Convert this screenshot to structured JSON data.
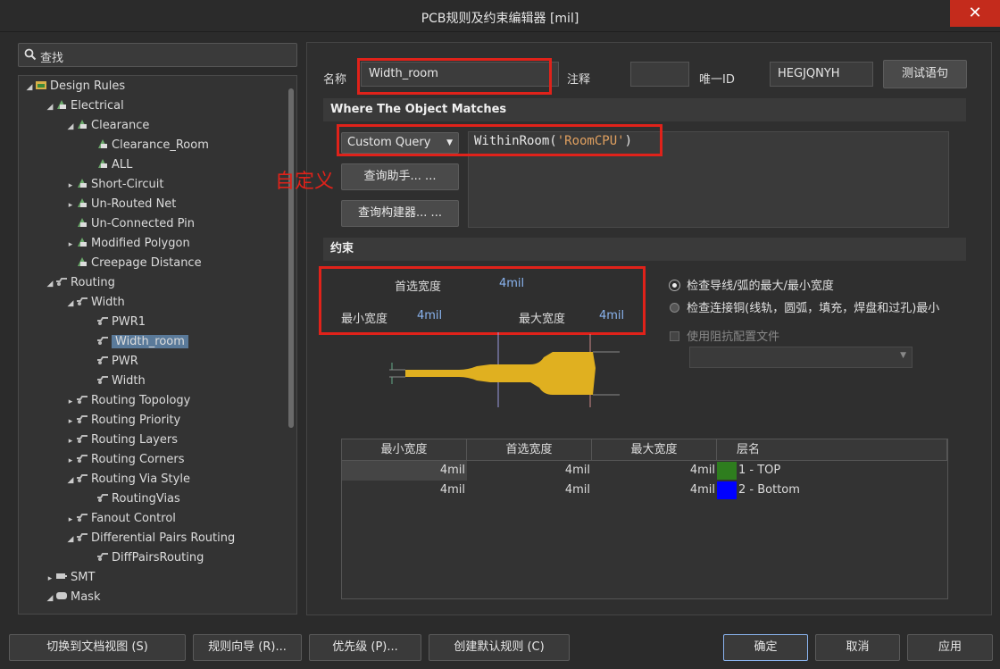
{
  "window": {
    "title": "PCB规则及约束编辑器 [mil]",
    "close_glyph": "✕"
  },
  "search": {
    "text": "查找"
  },
  "tree": {
    "items": [
      {
        "label": "Design Rules"
      },
      {
        "label": "Electrical"
      },
      {
        "label": "Clearance"
      },
      {
        "label": "Clearance_Room"
      },
      {
        "label": "ALL"
      },
      {
        "label": "Short-Circuit"
      },
      {
        "label": "Un-Routed Net"
      },
      {
        "label": "Un-Connected Pin"
      },
      {
        "label": "Modified Polygon"
      },
      {
        "label": "Creepage Distance"
      },
      {
        "label": "Routing"
      },
      {
        "label": "Width"
      },
      {
        "label": "PWR1"
      },
      {
        "label": "Width_room"
      },
      {
        "label": "PWR"
      },
      {
        "label": "Width"
      },
      {
        "label": "Routing Topology"
      },
      {
        "label": "Routing Priority"
      },
      {
        "label": "Routing Layers"
      },
      {
        "label": "Routing Corners"
      },
      {
        "label": "Routing Via Style"
      },
      {
        "label": "RoutingVias"
      },
      {
        "label": "Fanout Control"
      },
      {
        "label": "Differential Pairs Routing"
      },
      {
        "label": "DiffPairsRouting"
      },
      {
        "label": "SMT"
      },
      {
        "label": "Mask"
      }
    ]
  },
  "rule": {
    "name_label": "名称",
    "name_value": "Width_room",
    "comment_label": "注释",
    "comment_value": "",
    "uid_label": "唯一ID",
    "uid_value": "HEGJQNYH",
    "test_button": "测试语句"
  },
  "match": {
    "section_title": "Where The Object Matches",
    "query_type": "Custom Query",
    "query_prefix": "WithinRoom(",
    "query_arg": "'RoomCPU'",
    "query_suffix": ")",
    "helper_button": "查询助手... ...",
    "builder_button": "查询构建器... ...",
    "annotation": "自定义"
  },
  "constraints": {
    "section_title": "约束",
    "preferred_label": "首选宽度",
    "preferred_value": "4mil",
    "min_label": "最小宽度",
    "min_value": "4mil",
    "max_label": "最大宽度",
    "max_value": "4mil",
    "radio1": "检查导线/弧的最大/最小宽度",
    "radio2": "检查连接铜(线轨，圆弧，填充，焊盘和过孔)最小",
    "impedance": "使用阻抗配置文件"
  },
  "layer_table": {
    "headers": [
      "最小宽度",
      "首选宽度",
      "最大宽度",
      "层名"
    ],
    "rows": [
      {
        "min": "4mil",
        "pref": "4mil",
        "max": "4mil",
        "layer": "1 - TOP",
        "color": "#2e7d1e"
      },
      {
        "min": "4mil",
        "pref": "4mil",
        "max": "4mil",
        "layer": "2 - Bottom",
        "color": "#0000ff"
      }
    ]
  },
  "footer": {
    "doc_view": "切换到文档视图 (S)",
    "wizard": "规则向导 (R)...",
    "priority": "优先级 (P)...",
    "create_default": "创建默认规则 (C)",
    "ok": "确定",
    "cancel": "取消",
    "apply": "应用"
  }
}
